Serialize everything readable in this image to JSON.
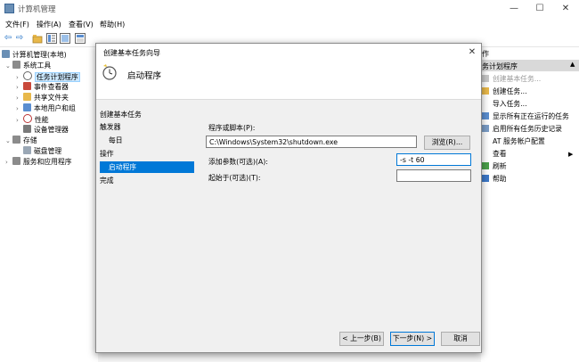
{
  "window": {
    "title": "计算机管理",
    "min_glyph": "—",
    "max_glyph": "☐",
    "close_glyph": "✕"
  },
  "menu": [
    "文件(F)",
    "操作(A)",
    "查看(V)",
    "帮助(H)"
  ],
  "toolbar": {
    "back_glyph": "⇦",
    "forward_glyph": "⇨"
  },
  "tree": {
    "root": "计算机管理(本地)",
    "system_tools": "系统工具",
    "task_scheduler": "任务计划程序",
    "event_viewer": "事件查看器",
    "shared_folders": "共享文件夹",
    "local_users": "本地用户和组",
    "performance": "性能",
    "device_manager": "设备管理器",
    "storage": "存储",
    "disk_management": "磁盘管理",
    "services": "服务和应用程序"
  },
  "actions": {
    "header": "作",
    "section": "务计划程序",
    "items": [
      {
        "label": "创建基本任务...",
        "disabled": true
      },
      {
        "label": "创建任务...",
        "disabled": false
      },
      {
        "label": "导入任务...",
        "disabled": false
      },
      {
        "label": "显示所有正在运行的任务",
        "disabled": false
      },
      {
        "label": "启用所有任务历史记录",
        "disabled": false
      },
      {
        "label": "AT 服务帐户配置",
        "disabled": false
      },
      {
        "label": "查看",
        "disabled": false
      },
      {
        "label": "刷新",
        "disabled": false
      },
      {
        "label": "帮助",
        "disabled": false
      }
    ],
    "submenu_arrow": "▶"
  },
  "dialog": {
    "title": "创建基本任务向导",
    "close_glyph": "✕",
    "header_title": "启动程序",
    "nav": {
      "create_basic_task": "创建基本任务",
      "trigger": "触发器",
      "daily": "每日",
      "action": "操作",
      "start_program": "启动程序",
      "finish": "完成"
    },
    "program_label": "程序或脚本(P):",
    "program_value": "C:\\Windows\\System32\\shutdown.exe",
    "browse_button": "浏览(R)...",
    "args_label": "添加参数(可选)(A):",
    "args_value": "-s -t 60",
    "start_in_label": "起始于(可选)(T):",
    "start_in_value": "",
    "back_button": "< 上一步(B)",
    "next_button": "下一步(N) >",
    "cancel_button": "取消"
  }
}
